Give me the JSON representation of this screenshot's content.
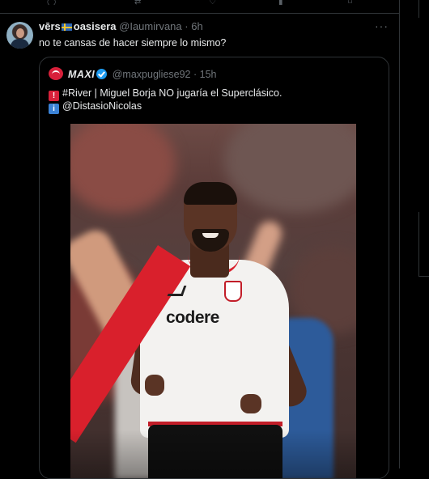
{
  "tweet": {
    "display_name": "vērs",
    "flag_icon": "sweden-flag-icon",
    "display_name_suffix": "oasisera",
    "handle": "@Iaumirvana",
    "separator": "·",
    "time": "6h",
    "more_label": "···",
    "text": "no te cansas de hacer siempre lo mismo?"
  },
  "quote": {
    "display_name": "MAXI",
    "verified_icon": "verified-badge-icon",
    "handle": "@maxpugliese92",
    "separator": "·",
    "time": "15h",
    "line1_emoji": "🚨",
    "line1_text": "#River | Miguel Borja NO jugaría el Superclásico.",
    "line2_emoji": "ℹ️",
    "line2_text": "@DistasioNicolas",
    "media_sponsor_text": "codere"
  },
  "colors": {
    "background": "#000000",
    "text_primary": "#e7e9ea",
    "text_secondary": "#71767b",
    "border": "#2f3336",
    "verified_blue": "#1d9bf0",
    "river_red": "#d9202c"
  }
}
